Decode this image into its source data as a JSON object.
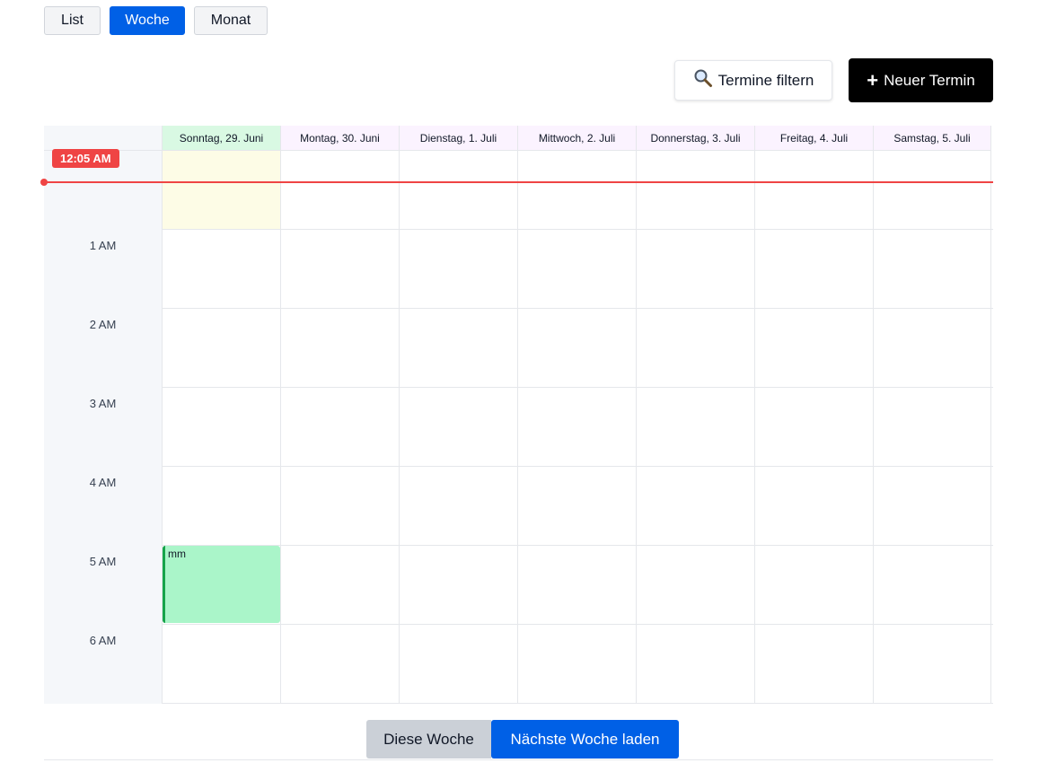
{
  "views": {
    "list_label": "List",
    "week_label": "Woche",
    "month_label": "Monat",
    "active": "Woche"
  },
  "toolbar": {
    "filter_icon": "magnifier-icon",
    "filter_label": "Termine filtern",
    "new_icon": "plus-icon",
    "new_label": "Neuer Termin"
  },
  "calendar": {
    "days": [
      {
        "label": "Sonntag, 29. Juni",
        "today": true
      },
      {
        "label": "Montag, 30. Juni",
        "today": false
      },
      {
        "label": "Dienstag, 1. Juli",
        "today": false
      },
      {
        "label": "Mittwoch, 2. Juli",
        "today": false
      },
      {
        "label": "Donnerstag, 3. Juli",
        "today": false
      },
      {
        "label": "Freitag, 4. Juli",
        "today": false
      },
      {
        "label": "Samstag, 5. Juli",
        "today": false
      }
    ],
    "hours": [
      "1 AM",
      "2 AM",
      "3 AM",
      "4 AM",
      "5 AM",
      "6 AM"
    ],
    "now_label": "12:05 AM",
    "events": [
      {
        "title": "mm",
        "day": "Sonntag, 29. Juni",
        "start": "5 AM",
        "color": "#aaf5c9",
        "accent": "#16a34a"
      }
    ]
  },
  "footer": {
    "this_week_label": "Diese Woche",
    "next_week_label": "Nächste Woche laden"
  },
  "colors": {
    "primary": "#0060e6",
    "now_indicator": "#ef4444",
    "today_header": "#d9f9e3",
    "day_header": "#fbf3ff"
  }
}
